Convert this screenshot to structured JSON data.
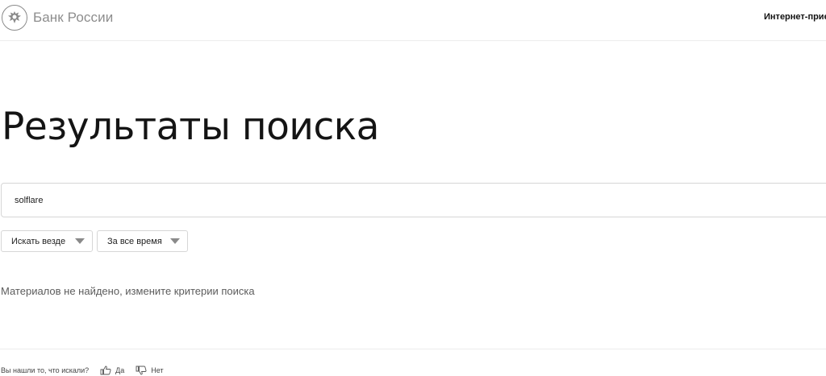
{
  "header": {
    "logo_text": "Банк России",
    "nav_link": "Интернет-приемная"
  },
  "main": {
    "title": "Результаты поиска",
    "search": {
      "value": "solflare"
    },
    "filters": [
      {
        "label": "Искать везде"
      },
      {
        "label": "За все время"
      }
    ],
    "empty_message": "Материалов не найдено, измените критерии поиска"
  },
  "feedback": {
    "question": "Вы нашли то, что искали?",
    "yes": "Да",
    "no": "Нет"
  },
  "colors": {
    "border": "#d6d6d6",
    "muted_text": "#8d8d8d",
    "title_text": "#141414"
  }
}
